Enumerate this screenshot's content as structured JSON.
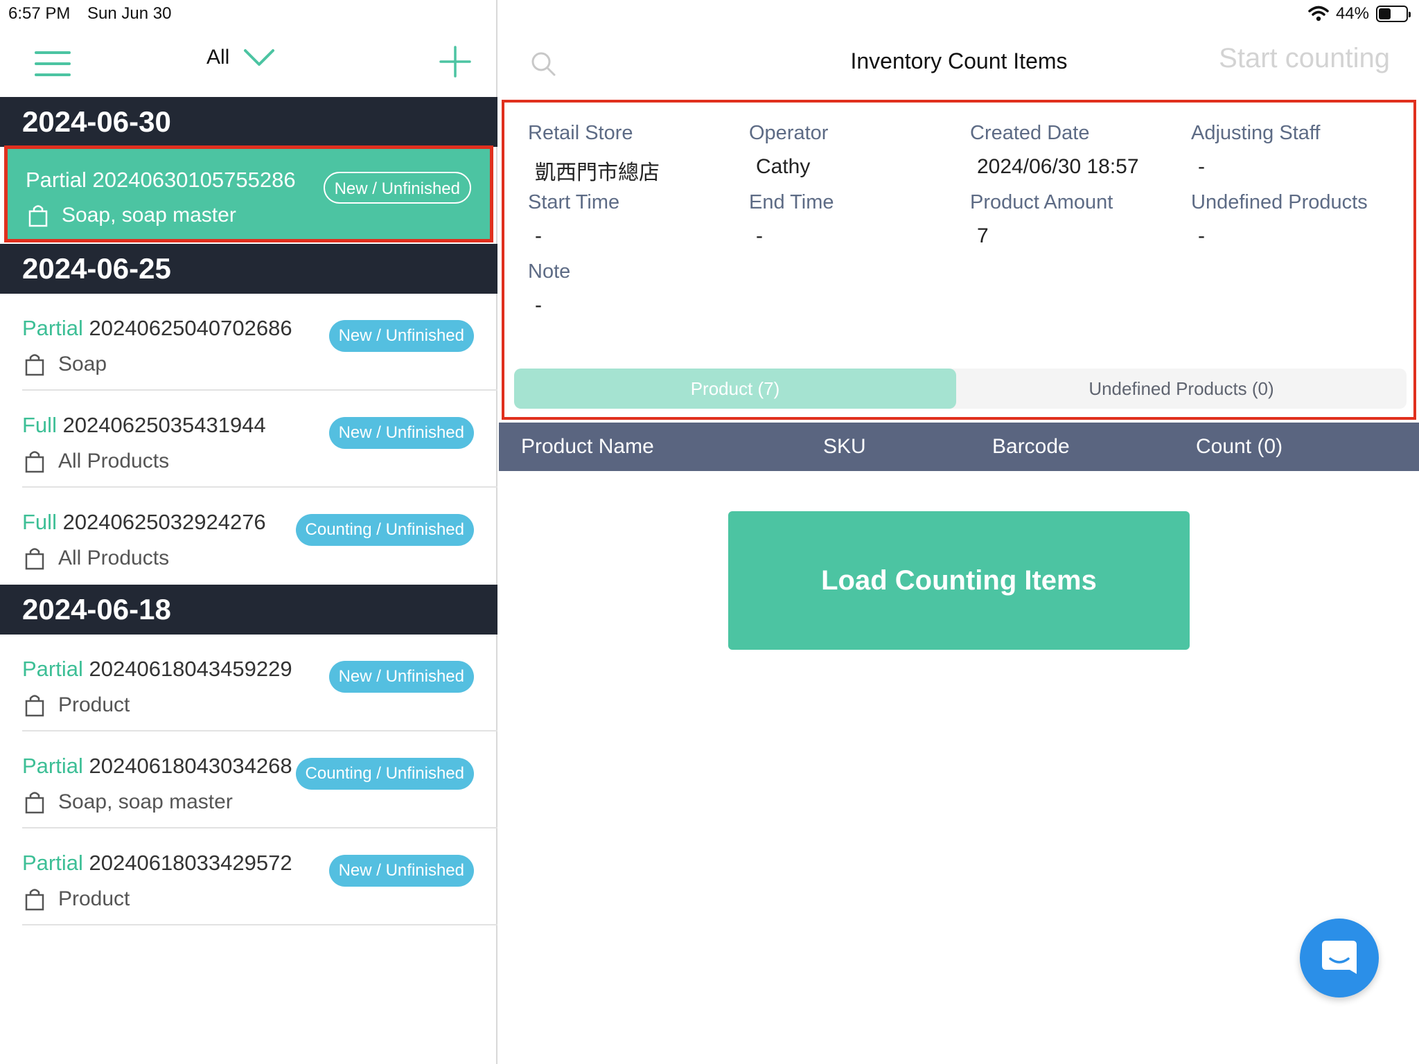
{
  "status_bar": {
    "time": "6:57 PM",
    "date": "Sun Jun 30",
    "battery": "44%",
    "battery_level": 0.44
  },
  "left_header": {
    "filter_label": "All"
  },
  "groups": [
    {
      "date": "2024-06-30",
      "items": [
        {
          "type": "Partial",
          "id": "20240630105755286",
          "products": "Soap, soap master",
          "status": "New / Unfinished"
        }
      ]
    },
    {
      "date": "2024-06-25",
      "items": [
        {
          "type": "Partial",
          "id": "20240625040702686",
          "products": "Soap",
          "status": "New / Unfinished"
        },
        {
          "type": "Full",
          "id": "20240625035431944",
          "products": "All Products",
          "status": "New / Unfinished"
        },
        {
          "type": "Full",
          "id": "20240625032924276",
          "products": "All Products",
          "status": "Counting / Unfinished"
        }
      ]
    },
    {
      "date": "2024-06-18",
      "items": [
        {
          "type": "Partial",
          "id": "20240618043459229",
          "products": "Product",
          "status": "New / Unfinished"
        },
        {
          "type": "Partial",
          "id": "20240618043034268",
          "products": "Soap, soap master",
          "status": "Counting / Unfinished"
        },
        {
          "type": "Partial",
          "id": "20240618033429572",
          "products": "Product",
          "status": "New / Unfinished"
        }
      ]
    }
  ],
  "right_header": {
    "title": "Inventory Count Items",
    "start_counting": "Start counting"
  },
  "details": {
    "retail_store_label": "Retail Store",
    "retail_store": "凱西門市總店",
    "operator_label": "Operator",
    "operator": "Cathy",
    "created_date_label": "Created Date",
    "created_date": "2024/06/30 18:57",
    "adjusting_staff_label": "Adjusting Staff",
    "adjusting_staff": "-",
    "start_time_label": "Start Time",
    "start_time": "-",
    "end_time_label": "End Time",
    "end_time": "-",
    "product_amount_label": "Product Amount",
    "product_amount": "7",
    "undefined_products_label": "Undefined Products",
    "undefined_products": "-",
    "note_label": "Note",
    "note": "-"
  },
  "tabs": {
    "product": "Product (7)",
    "undefined": "Undefined Products (0)"
  },
  "table": {
    "columns": [
      "Product Name",
      "SKU",
      "Barcode",
      "Count (0)"
    ]
  },
  "load_button": "Load Counting Items",
  "colors": {
    "accent_green": "#4cc4a2",
    "badge_blue": "#54bfe0",
    "dark_header": "#222834",
    "highlight_red": "#e0301e",
    "table_header": "#5a6580",
    "chat_blue": "#2b8fe8"
  }
}
